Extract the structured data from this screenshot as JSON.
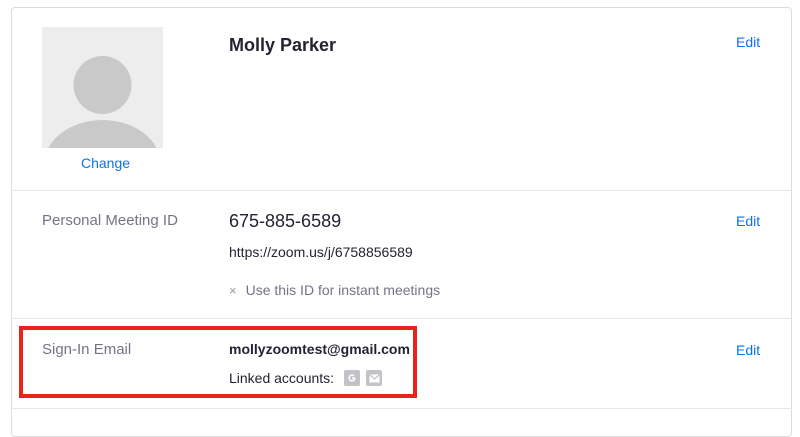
{
  "profile": {
    "name": "Molly Parker",
    "change_photo_label": "Change",
    "edit_label": "Edit",
    "avatar_icon": "person-silhouette-icon"
  },
  "meeting": {
    "label": "Personal Meeting ID",
    "id": "675-885-6589",
    "url": "https://zoom.us/j/6758856589",
    "instant_option_mark": "×",
    "instant_option": "Use this ID for instant meetings",
    "edit_label": "Edit"
  },
  "signin": {
    "label": "Sign-In Email",
    "email": "mollyzoomtest@gmail.com",
    "linked_label": "Linked accounts:",
    "linked_icons": [
      "google-icon",
      "email-icon"
    ],
    "edit_label": "Edit"
  },
  "colors": {
    "link": "#0e72ed",
    "highlight": "#e8231a",
    "label": "#747487"
  }
}
